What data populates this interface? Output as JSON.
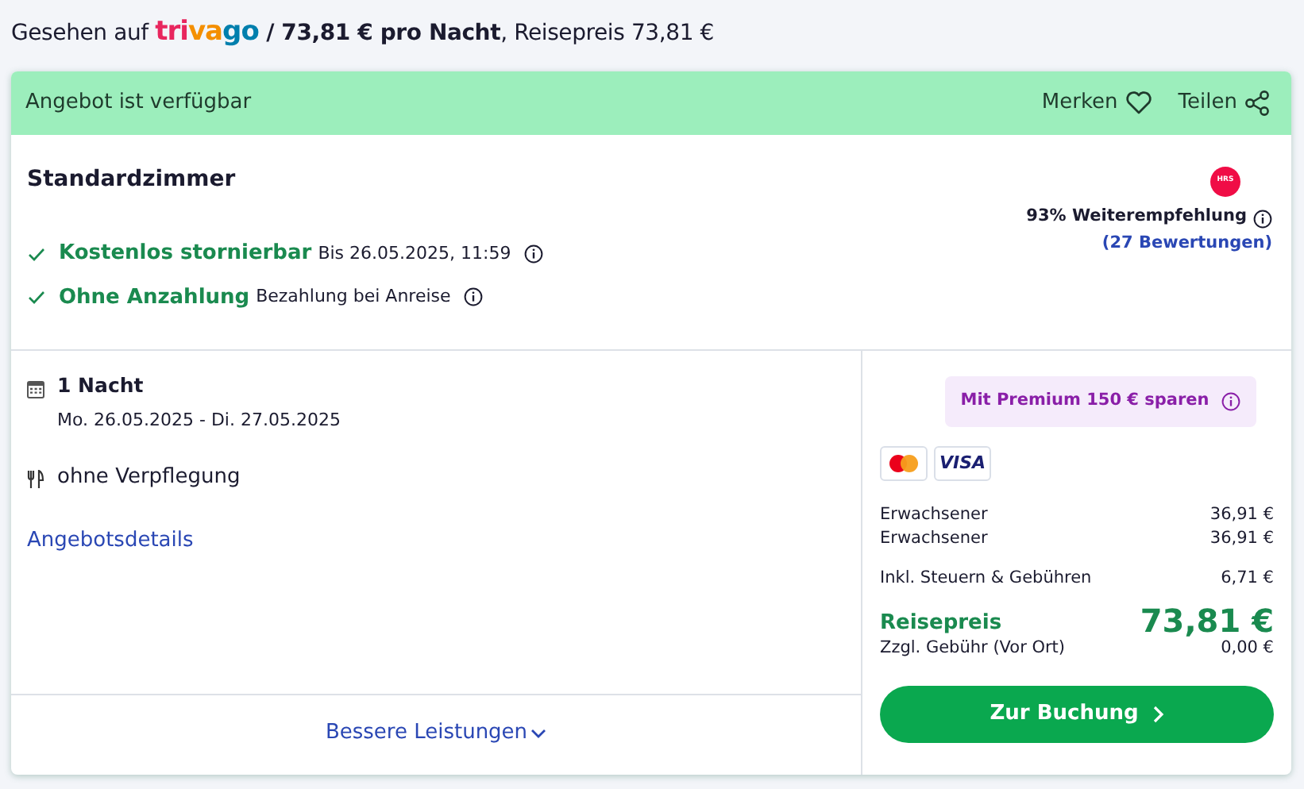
{
  "seen_line": {
    "prefix": "Gesehen auf",
    "logo": [
      {
        "text": "tri",
        "color": "#e8265e"
      },
      {
        "text": "va",
        "color": "#f48f00"
      },
      {
        "text": "go",
        "color": "#007fad"
      }
    ],
    "price": "/ 73,81 € pro Nacht",
    "suffix": ", Reisepreis 73,81 €"
  },
  "availability": {
    "text": "Angebot ist verfügbar",
    "actions": [
      "Merken",
      "Teilen"
    ]
  },
  "room": {
    "name": "Standardzimmer",
    "provider_badge": "HRS",
    "recommendation": "93% Weiterempfehlung",
    "reviews": "(27 Bewertungen)",
    "features": [
      {
        "title": "Kostenlos stornierbar",
        "detail": "Bis 26.05.2025, 11:59"
      },
      {
        "title": "Ohne Anzahlung",
        "detail": "Bezahlung bei Anreise"
      }
    ]
  },
  "stay": {
    "nights": "1 Nacht",
    "dates": "Mo. 26.05.2025 - Di. 27.05.2025",
    "board": "ohne Verpflegung",
    "details_link": "Angebotsdetails",
    "more_link": "Bessere Leistungen"
  },
  "pricing": {
    "premium": "Mit Premium 150 € sparen",
    "card_brands": [
      {
        "kind": "mastercard"
      },
      {
        "kind": "visa",
        "text": "VISA"
      }
    ],
    "lines": [
      {
        "label": "Erwachsener",
        "amount": "36,91 €"
      },
      {
        "label": "Erwachsener",
        "amount": "36,91 €"
      },
      {
        "label": "Inkl. Steuern & Gebühren",
        "amount": "6,71 €"
      }
    ],
    "total_label": "Reisepreis",
    "total": "73,81 €",
    "fee_label": "Zzgl. Gebühr (Vor Ort)",
    "fee": "0,00 €",
    "button": "Zur Buchung"
  }
}
